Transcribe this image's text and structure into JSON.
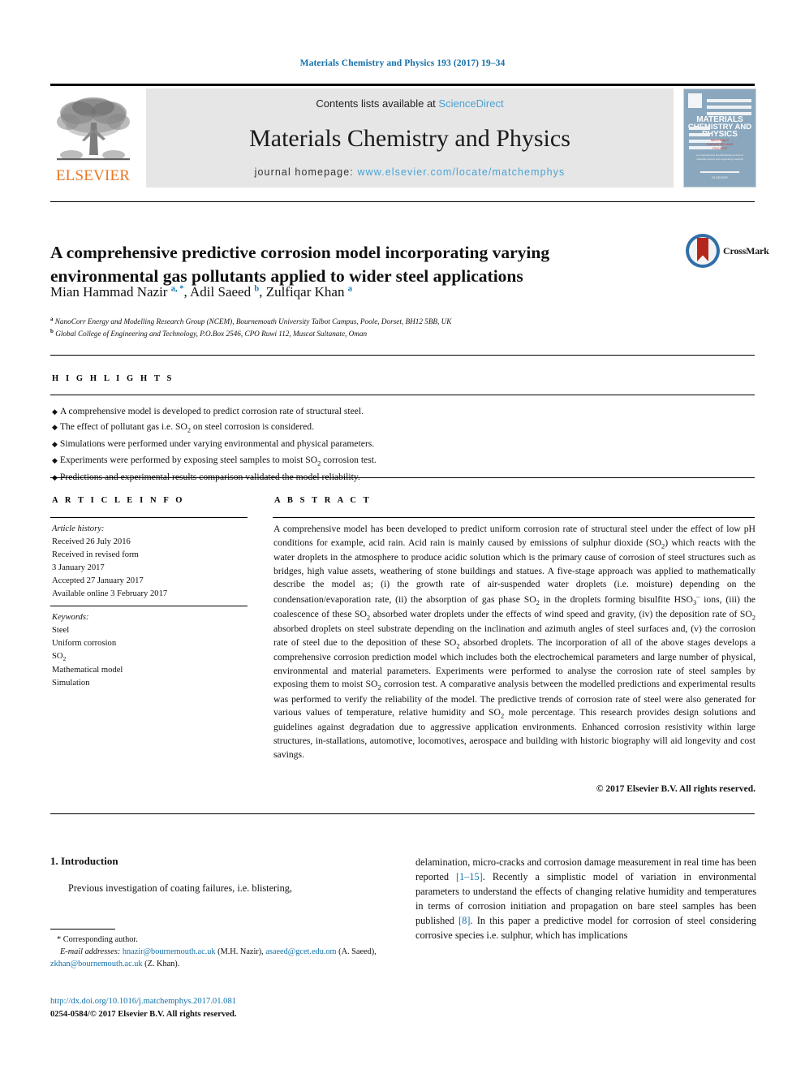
{
  "running_head": "Materials Chemistry and Physics 193 (2017) 19–34",
  "masthead": {
    "contents_prefix": "Contents lists available at ",
    "sciencedirect": "ScienceDirect",
    "journal_title": "Materials Chemistry and Physics",
    "homepage_prefix": "journal homepage: ",
    "homepage_url": "www.elsevier.com/locate/matchemphys",
    "publisher_name": "ELSEVIER",
    "publisher_logo_icon": "elsevier-tree-icon",
    "cover": {
      "line1": "MATERIALS",
      "line2": "CHEMISTRY AND",
      "line3": "PHYSICS",
      "sub1": "MATERIALS",
      "sub2": "CHEMISTRY AND",
      "sub3": "PHYSICS",
      "tiny1": "A comprehensive interdisciplinary journal of",
      "tiny2": "materials science and engineering research",
      "footer": "ELSEVIER"
    }
  },
  "crossmark": {
    "label": "CrossMark",
    "icon": "crossmark-icon"
  },
  "article": {
    "title": "A comprehensive predictive corrosion model incorporating varying environmental gas pollutants applied to wider steel applications",
    "authors_html": "Mian Hammad Nazir <sup>a, *</sup>, Adil Saeed <sup>b</sup>, Zulfiqar Khan <sup>a</sup>",
    "affiliations": [
      {
        "marker": "a",
        "text": "NanoCorr Energy and Modelling Research Group (NCEM), Bournemouth University Talbot Campus, Poole, Dorset, BH12 5BB, UK"
      },
      {
        "marker": "b",
        "text": "Global College of Engineering and Technology, P.O.Box 2546, CPO Ruwi 112, Muscat Sultanate, Oman"
      }
    ]
  },
  "highlights": {
    "label": "H I G H L I G H T S",
    "items_html": [
      "A comprehensive model is developed to predict corrosion rate of structural steel.",
      "The effect of pollutant gas i.e. SO<sub>2</sub> on steel corrosion is considered.",
      "Simulations were performed under varying environmental and physical parameters.",
      "Experiments were performed by exposing steel samples to moist SO<sub>2</sub> corrosion test.",
      "Predictions and experimental results comparison validated the model reliability."
    ]
  },
  "article_info": {
    "label": "A R T I C L E    I N F O",
    "history_heading": "Article history:",
    "history_lines": [
      "Received 26 July 2016",
      "Received in revised form",
      "3 January 2017",
      "Accepted 27 January 2017",
      "Available online 3 February 2017"
    ],
    "keywords_heading": "Keywords:",
    "keywords_html": [
      "Steel",
      "Uniform corrosion",
      "SO<sub>2</sub>",
      "Mathematical model",
      "Simulation"
    ]
  },
  "abstract": {
    "label": "A B S T R A C T",
    "text_html": "A comprehensive model has been developed to predict uniform corrosion rate of structural steel under the effect of low pH conditions for example, acid rain. Acid rain is mainly caused by emissions of sulphur dioxide (SO<sub>2</sub>) which reacts with the water droplets in the atmosphere to produce acidic solution which is the primary cause of corrosion of steel structures such as bridges, high value assets, weathering of stone buildings and statues. A five-stage approach was applied to mathematically describe the model as; (i) the growth rate of air-suspended water droplets (i.e. moisture) depending on the condensation/evaporation rate, (ii) the absorption of gas phase SO<sub>2</sub> in the droplets forming bisulfite HSO<sub>3</sub><sup class=\"ion\">&#8211;</sup> ions, (iii) the coalescence of these SO<sub>2</sub> absorbed water droplets under the effects of wind speed and gravity, (iv) the deposition rate of SO<sub>2</sub> absorbed droplets on steel substrate depending on the inclination and azimuth angles of steel surfaces and, (v) the corrosion rate of steel due to the deposition of these SO<sub>2</sub> absorbed droplets. The incorporation of all of the above stages develops a comprehensive corrosion prediction model which includes both the electrochemical parameters and large number of physical, environmental and material parameters. Experiments were performed to analyse the corrosion rate of steel samples by exposing them to moist SO<sub>2</sub> corrosion test. A comparative analysis between the modelled predictions and experimental results was performed to verify the reliability of the model. The predictive trends of corrosion rate of steel were also generated for various values of temperature, relative humidity and SO<sub>2</sub> mole percentage. This research provides design solutions and guidelines against degradation due to aggressive application environments. Enhanced corrosion resistivity within large structures, in-stallations, automotive, locomotives, aerospace and building with historic biography will aid longevity and cost savings.",
    "copyright": "© 2017 Elsevier B.V. All rights reserved."
  },
  "body": {
    "section_heading": "1. Introduction",
    "left_paragraph": "Previous investigation of coating failures, i.e. blistering,",
    "right_paragraph_html": "delamination, micro-cracks and corrosion damage measurement in real time has been reported <span class=\"ref-link\">[1–15]</span>. Recently a simplistic model of variation in environmental parameters to understand the effects of changing relative humidity and temperatures in terms of corrosion initiation and propagation on bare steel samples has been published <span class=\"ref-link\">[8]</span>. In this paper a predictive model for corrosion of steel considering corrosive species i.e. sulphur, which has implications"
  },
  "footnotes": {
    "corresponding_author": "Corresponding author.",
    "email_label": "E-mail addresses:",
    "emails_html": " <span class=\"mail\">hnazir@bournemouth.ac.uk</span> (M.H. Nazir), <span class=\"mail\">asaeed@gcet.edu.om</span> (A. Saeed), <span class=\"mail\">zkhan@bournemouth.ac.uk</span> (Z. Khan).",
    "doi": "http://dx.doi.org/10.1016/j.matchemphys.2017.01.081",
    "issn_line": "0254-0584/© 2017 Elsevier B.V. All rights reserved."
  },
  "colors": {
    "link_blue": "#1270a8",
    "sciencedirect_blue": "#49a2d4",
    "elsevier_orange": "#e87722",
    "cover_blue": "#8aa7bd",
    "crossmark_blue": "#2f6fa8",
    "crossmark_red": "#b5271c"
  }
}
